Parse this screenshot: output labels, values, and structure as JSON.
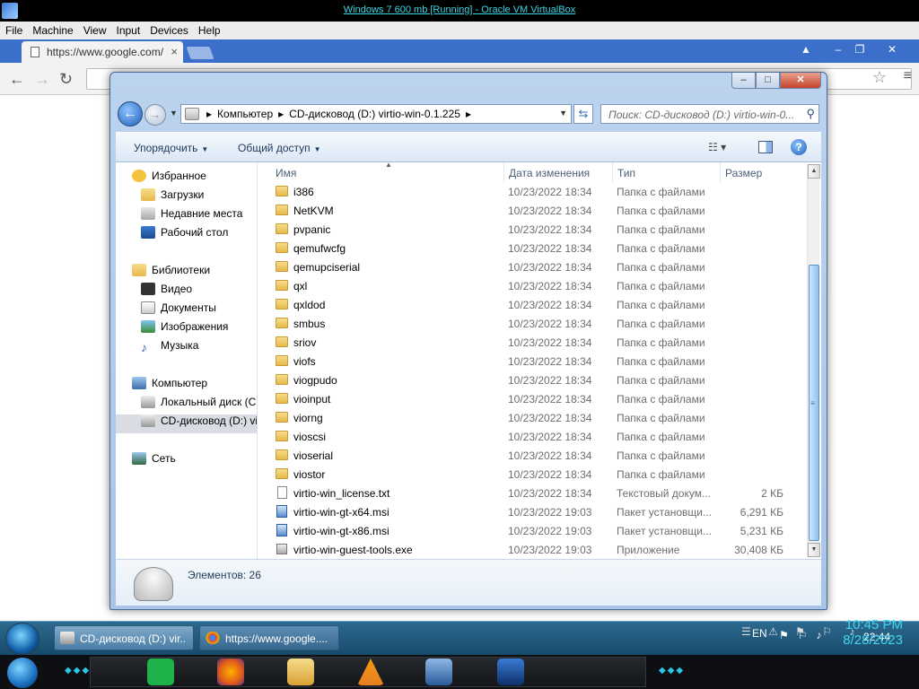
{
  "host": {
    "title": "Windows 7 600 mb [Running] - Oracle VM VirtualBox",
    "menu": [
      "File",
      "Machine",
      "View",
      "Input",
      "Devices",
      "Help"
    ]
  },
  "chrome": {
    "tab_label": "https://www.google.com/",
    "tab_close": "×",
    "window_controls": [
      "▲",
      "–",
      "❐",
      "✕"
    ]
  },
  "explorer": {
    "window_controls": [
      "–",
      "□",
      "✕"
    ],
    "breadcrumb": [
      "Компьютер",
      "CD-дисковод (D:) virtio-win-0.1.225"
    ],
    "search_placeholder": "Поиск: CD-дисковод (D:) virtio-win-0...",
    "commands": [
      "Упорядочить",
      "Общий доступ"
    ],
    "nav": {
      "favorites": "Избранное",
      "downloads": "Загрузки",
      "recent": "Недавние места",
      "desktop": "Рабочий стол",
      "libraries": "Библиотеки",
      "video": "Видео",
      "documents": "Документы",
      "images": "Изображения",
      "music": "Музыка",
      "computer": "Компьютер",
      "local_disk": "Локальный диск (C",
      "cd_drive": "CD-дисковод (D:) vi",
      "network": "Сеть"
    },
    "columns": [
      "Имя",
      "Дата изменения",
      "Тип",
      "Размер"
    ],
    "files": [
      {
        "name": "i386",
        "date": "10/23/2022 18:34",
        "type": "Папка с файлами",
        "size": "",
        "kind": "folder"
      },
      {
        "name": "NetKVM",
        "date": "10/23/2022 18:34",
        "type": "Папка с файлами",
        "size": "",
        "kind": "folder"
      },
      {
        "name": "pvpanic",
        "date": "10/23/2022 18:34",
        "type": "Папка с файлами",
        "size": "",
        "kind": "folder"
      },
      {
        "name": "qemufwcfg",
        "date": "10/23/2022 18:34",
        "type": "Папка с файлами",
        "size": "",
        "kind": "folder"
      },
      {
        "name": "qemupciserial",
        "date": "10/23/2022 18:34",
        "type": "Папка с файлами",
        "size": "",
        "kind": "folder"
      },
      {
        "name": "qxl",
        "date": "10/23/2022 18:34",
        "type": "Папка с файлами",
        "size": "",
        "kind": "folder"
      },
      {
        "name": "qxldod",
        "date": "10/23/2022 18:34",
        "type": "Папка с файлами",
        "size": "",
        "kind": "folder"
      },
      {
        "name": "smbus",
        "date": "10/23/2022 18:34",
        "type": "Папка с файлами",
        "size": "",
        "kind": "folder"
      },
      {
        "name": "sriov",
        "date": "10/23/2022 18:34",
        "type": "Папка с файлами",
        "size": "",
        "kind": "folder"
      },
      {
        "name": "viofs",
        "date": "10/23/2022 18:34",
        "type": "Папка с файлами",
        "size": "",
        "kind": "folder"
      },
      {
        "name": "viogpudo",
        "date": "10/23/2022 18:34",
        "type": "Папка с файлами",
        "size": "",
        "kind": "folder"
      },
      {
        "name": "vioinput",
        "date": "10/23/2022 18:34",
        "type": "Папка с файлами",
        "size": "",
        "kind": "folder"
      },
      {
        "name": "viorng",
        "date": "10/23/2022 18:34",
        "type": "Папка с файлами",
        "size": "",
        "kind": "folder"
      },
      {
        "name": "vioscsi",
        "date": "10/23/2022 18:34",
        "type": "Папка с файлами",
        "size": "",
        "kind": "folder"
      },
      {
        "name": "vioserial",
        "date": "10/23/2022 18:34",
        "type": "Папка с файлами",
        "size": "",
        "kind": "folder"
      },
      {
        "name": "viostor",
        "date": "10/23/2022 18:34",
        "type": "Папка с файлами",
        "size": "",
        "kind": "folder"
      },
      {
        "name": "virtio-win_license.txt",
        "date": "10/23/2022 18:34",
        "type": "Текстовый докум...",
        "size": "2 КБ",
        "kind": "txt"
      },
      {
        "name": "virtio-win-gt-x64.msi",
        "date": "10/23/2022 19:03",
        "type": "Пакет установщи...",
        "size": "6,291 КБ",
        "kind": "msi"
      },
      {
        "name": "virtio-win-gt-x86.msi",
        "date": "10/23/2022 19:03",
        "type": "Пакет установщи...",
        "size": "5,231 КБ",
        "kind": "msi"
      },
      {
        "name": "virtio-win-guest-tools.exe",
        "date": "10/23/2022 19:03",
        "type": "Приложение",
        "size": "30,408 КБ",
        "kind": "exe"
      }
    ],
    "status": "Элементов: 26"
  },
  "taskbar": {
    "tasks": [
      "CD-дисковод (D:) vir...",
      "https://www.google...."
    ],
    "lang": "EN",
    "time": "22:44"
  },
  "host_clock": {
    "time": "10:45 PM",
    "date": "8/28/2023"
  }
}
